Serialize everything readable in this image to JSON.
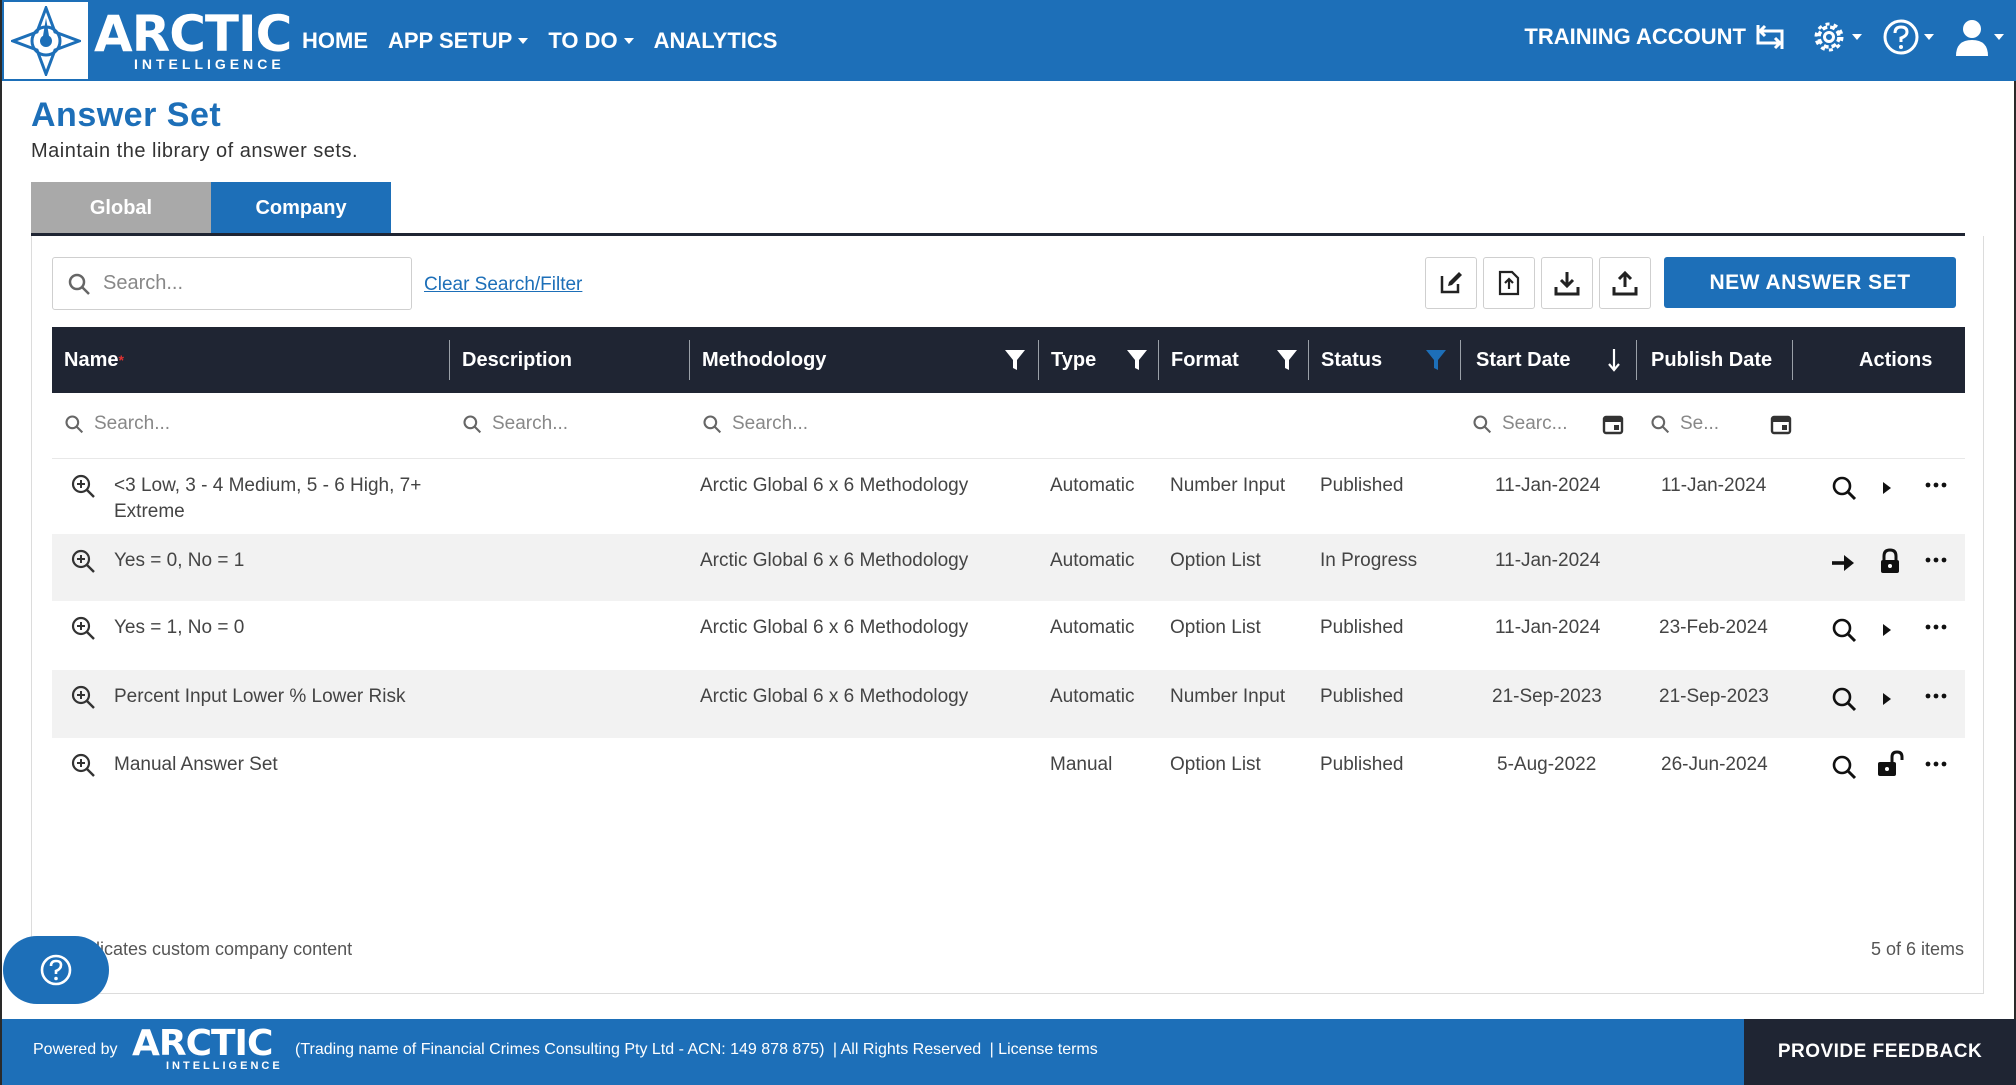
{
  "header": {
    "brand_word": "ARCTIC",
    "brand_sub": "INTELLIGENCE",
    "nav": [
      {
        "label": "HOME"
      },
      {
        "label": "APP SETUP"
      },
      {
        "label": "TO DO"
      },
      {
        "label": "ANALYTICS"
      }
    ],
    "account_label": "TRAINING ACCOUNT"
  },
  "page": {
    "title": "Answer Set",
    "subtitle": "Maintain the library of answer sets."
  },
  "tabs": [
    {
      "label": "Global",
      "active": false
    },
    {
      "label": "Company",
      "active": true
    }
  ],
  "toolbar": {
    "search_placeholder": "Search...",
    "clear_label": "Clear Search/Filter",
    "new_button_label": "NEW ANSWER SET",
    "tool_icons": [
      "edit-icon",
      "file-upload-icon",
      "download-icon",
      "upload-icon"
    ]
  },
  "table": {
    "columns": {
      "name": "Name",
      "description": "Description",
      "methodology": "Methodology",
      "type": "Type",
      "format": "Format",
      "status": "Status",
      "start_date": "Start Date",
      "publish_date": "Publish Date",
      "actions": "Actions"
    },
    "required_marker": "*",
    "filter_placeholders": {
      "name": "Search...",
      "description": "Search...",
      "methodology": "Search...",
      "start_date": "Searc...",
      "publish_date": "Se..."
    },
    "rows": [
      {
        "name": "<3 Low, 3 - 4 Medium, 5 - 6 High, 7+",
        "name2": "Extreme",
        "description": "",
        "methodology": "Arctic Global 6 x 6 Methodology",
        "type": "Automatic",
        "format": "Number Input",
        "status": "Published",
        "start_date": "11-Jan-2024",
        "publish_date": "11-Jan-2024",
        "actions": [
          "search-icon",
          "play-icon",
          "more-icon"
        ]
      },
      {
        "name": "Yes = 0, No = 1",
        "name2": "",
        "description": "",
        "methodology": "Arctic Global 6 x 6 Methodology",
        "type": "Automatic",
        "format": "Option List",
        "status": "In Progress",
        "start_date": "11-Jan-2024",
        "publish_date": "",
        "actions": [
          "arrow-right-icon",
          "lock-icon",
          "more-icon"
        ]
      },
      {
        "name": "Yes = 1, No = 0",
        "name2": "",
        "description": "",
        "methodology": "Arctic Global 6 x 6 Methodology",
        "type": "Automatic",
        "format": "Option List",
        "status": "Published",
        "start_date": "11-Jan-2024",
        "publish_date": "23-Feb-2024",
        "actions": [
          "search-icon",
          "play-icon",
          "more-icon"
        ]
      },
      {
        "name": "Percent Input Lower % Lower Risk",
        "name2": "",
        "description": "",
        "methodology": "Arctic Global 6 x 6 Methodology",
        "type": "Automatic",
        "format": "Number Input",
        "status": "Published",
        "start_date": "21-Sep-2023",
        "publish_date": "21-Sep-2023",
        "actions": [
          "search-icon",
          "play-icon",
          "more-icon"
        ]
      },
      {
        "name": "Manual Answer Set",
        "name2": "",
        "description": "",
        "methodology": "",
        "type": "Manual",
        "format": "Option List",
        "status": "Published",
        "start_date": "5-Aug-2022",
        "publish_date": "26-Jun-2024",
        "actions": [
          "search-icon",
          "unlock-icon",
          "more-icon"
        ]
      }
    ]
  },
  "footer_note": "licates custom company content",
  "items_count": "5 of 6 items",
  "bottom": {
    "powered_by": "Powered by",
    "brand_word": "ARCTIC",
    "brand_sub": "INTELLIGENCE",
    "legal_1": "(Trading name of Financial Crimes Consulting Pty Ltd - ACN: 149 878 875)",
    "legal_2": "| All Rights Reserved",
    "legal_3": "| License terms",
    "feedback_label": "PROVIDE FEEDBACK"
  },
  "colors": {
    "brand_blue": "#1d6fb8",
    "header_dark": "#1f2533",
    "tab_inactive": "#a9a9a9"
  }
}
